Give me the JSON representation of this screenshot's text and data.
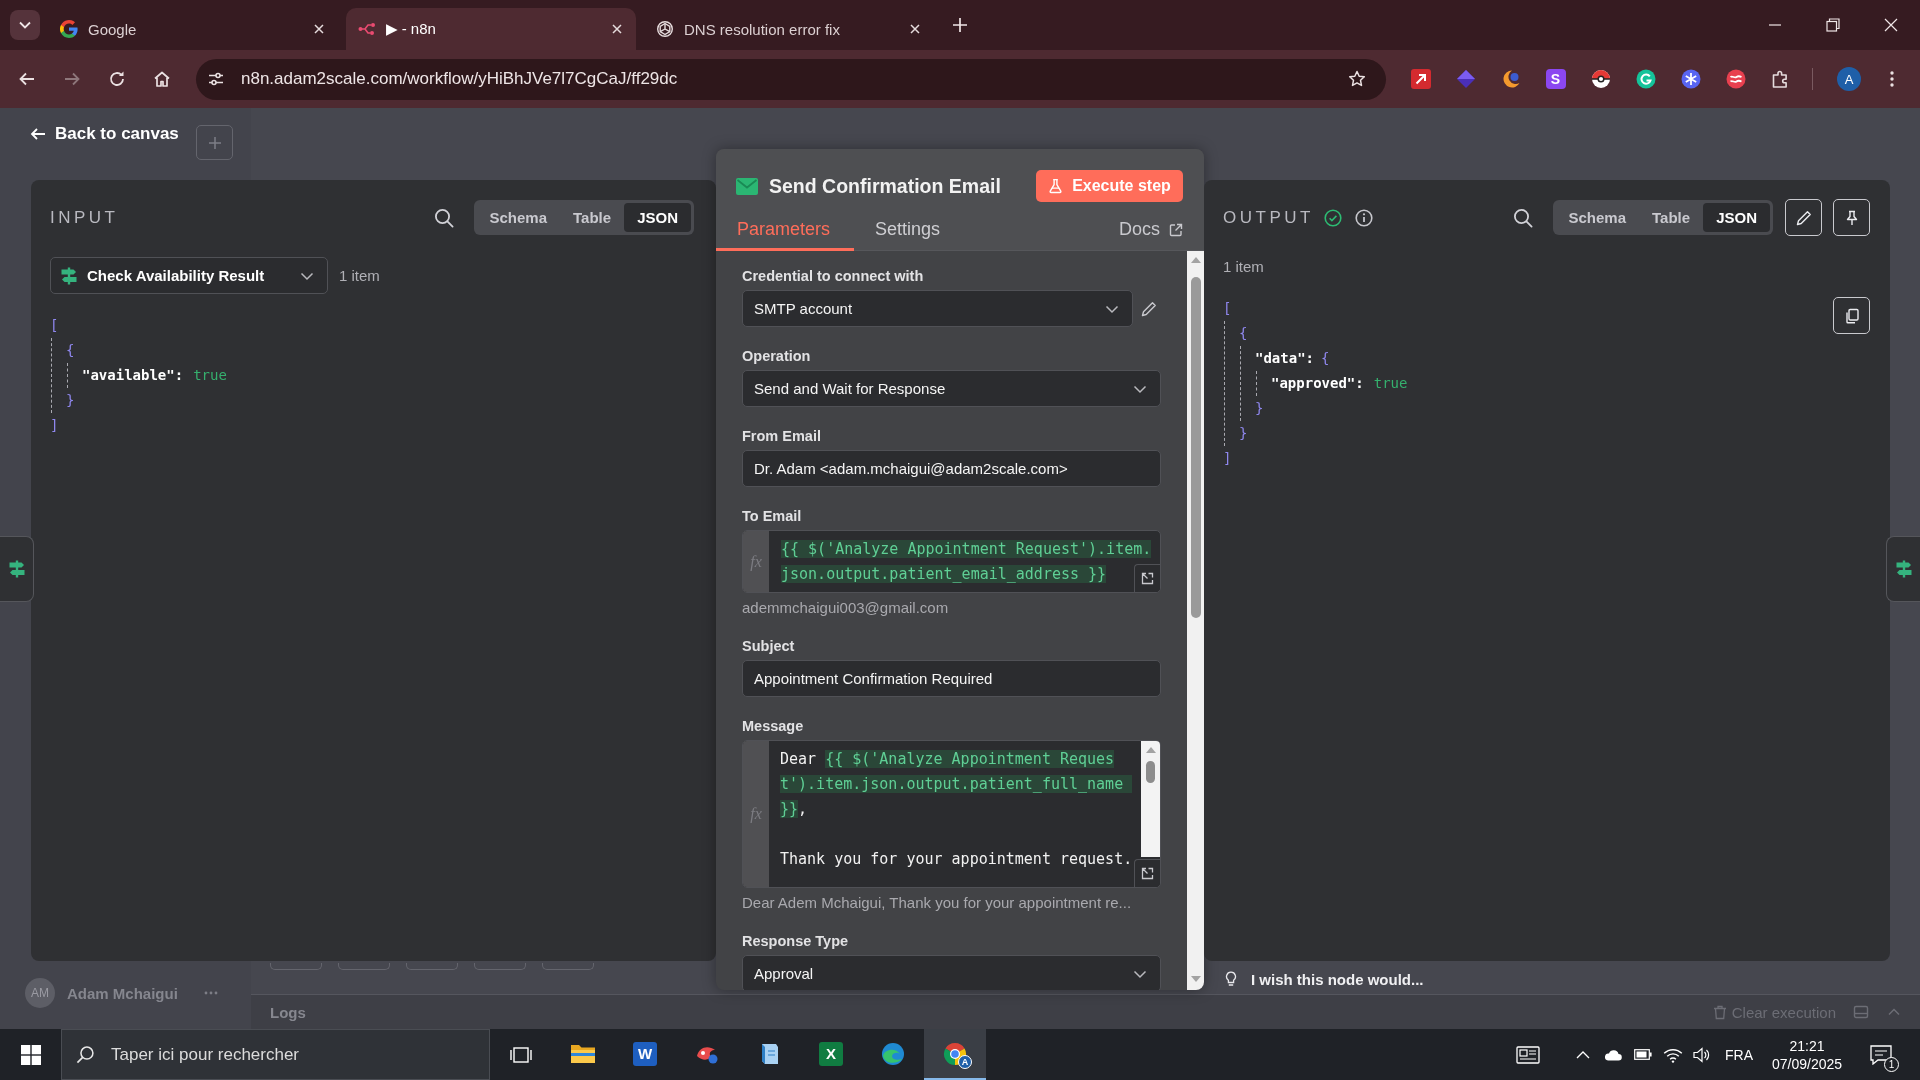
{
  "browser": {
    "tabs": [
      {
        "title": "Google",
        "selected": false
      },
      {
        "title": "▶ - n8n",
        "selected": true
      },
      {
        "title": "DNS resolution error fix",
        "selected": false
      }
    ],
    "url": "n8n.adam2scale.com/workflow/yHiBhJVe7l7CgCaJ/ff29dc",
    "extensions": [
      {
        "kind": "arrow"
      },
      {
        "kind": "diamond"
      },
      {
        "kind": "crescent"
      },
      {
        "kind": "letter",
        "label": "S"
      },
      {
        "kind": "ball"
      },
      {
        "kind": "ring"
      },
      {
        "kind": "snowflake"
      },
      {
        "kind": "stripes"
      },
      {
        "kind": "puzzle"
      }
    ],
    "profile": "A"
  },
  "ndv": {
    "back": "Back to canvas",
    "input": {
      "title": "INPUT",
      "views": [
        {
          "label": "Schema",
          "selected": false
        },
        {
          "label": "Table",
          "selected": false
        },
        {
          "label": "JSON",
          "selected": true
        }
      ],
      "source": "Check Availability Result",
      "count": "1 item",
      "json": {
        "open": "[",
        "close": "]",
        "children": [
          {
            "open": "{",
            "close": "}",
            "children": [
              {
                "key": "\"available\":",
                "value": "true"
              }
            ]
          }
        ]
      }
    },
    "node": {
      "title": "Send Confirmation Email",
      "execute": "Execute step",
      "tabs": [
        {
          "label": "Parameters",
          "selected": true
        },
        {
          "label": "Settings",
          "selected": false
        }
      ],
      "docs": "Docs",
      "fields": [
        {
          "kind": "credential",
          "label": "Credential to connect with",
          "value": "SMTP account"
        },
        {
          "kind": "dropdown",
          "label": "Operation",
          "value": "Send and Wait for Response"
        },
        {
          "kind": "input",
          "label": "From Email",
          "value": "Dr. Adam <adam.mchaigui@adam2scale.com>"
        },
        {
          "kind": "expression",
          "label": "To Email",
          "gutter": "fx",
          "segments": [
            {
              "kind": "expression",
              "text": "{{ $('Analyze Appointment Request').item.json.output.patient_email_address }}"
            }
          ],
          "preview": "ademmchaigui003@gmail.com"
        },
        {
          "kind": "input",
          "label": "Subject",
          "value": "Appointment Confirmation Required"
        },
        {
          "kind": "editor",
          "label": "Message",
          "gutter": "fx",
          "segments": [
            {
              "kind": "plain",
              "text": "Dear "
            },
            {
              "kind": "expression",
              "text": "{{ $('Analyze Appointment Request').item.json.output.patient_full_name }}"
            },
            {
              "kind": "plain",
              "text": ",\n\nThank you for your appointment request."
            }
          ],
          "preview": "Dear Adem Mchaigui, Thank you for your appointment re..."
        },
        {
          "kind": "dropdown",
          "label": "Response Type",
          "value": "Approval"
        }
      ]
    },
    "output": {
      "title": "OUTPUT",
      "views": [
        {
          "label": "Schema",
          "selected": false
        },
        {
          "label": "Table",
          "selected": false
        },
        {
          "label": "JSON",
          "selected": true
        }
      ],
      "count": "1 item",
      "json": {
        "open": "[",
        "close": "]",
        "children": [
          {
            "open": "{",
            "close": "}",
            "children": [
              {
                "key": "\"data\":",
                "open": "{",
                "close": "}",
                "children": [
                  {
                    "key": "\"approved\":",
                    "value": "true"
                  }
                ]
              }
            ]
          }
        ]
      }
    },
    "feedback": "I wish this node would..."
  },
  "canvas": {
    "user": {
      "initials": "AM",
      "name": "Adam Mchaigui"
    },
    "logs": {
      "title": "Logs",
      "clear": "Clear execution"
    }
  },
  "taskbar": {
    "search": {
      "placeholder": "Taper ici pour rechercher"
    },
    "apps": [
      {
        "kind": "folder",
        "selected": false
      },
      {
        "kind": "word",
        "label": "W",
        "selected": false
      },
      {
        "kind": "paint",
        "selected": false
      },
      {
        "kind": "notebook",
        "selected": false
      },
      {
        "kind": "excel",
        "label": "X",
        "selected": false
      },
      {
        "kind": "edge",
        "selected": false
      },
      {
        "kind": "chrome",
        "badge": "A",
        "selected": true
      }
    ],
    "language": "FRA",
    "time": "21:21",
    "date": "07/09/2025",
    "notifications": "1"
  }
}
